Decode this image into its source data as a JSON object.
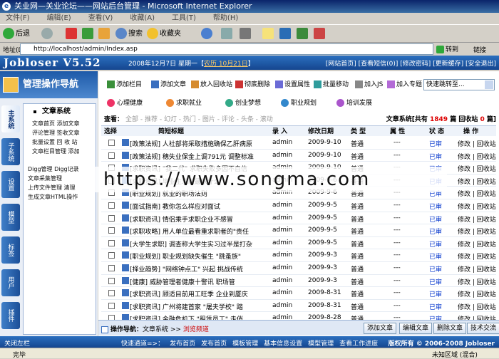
{
  "browser": {
    "title": "关业网—关业论坛——网站后台管理 - Microsoft Internet Explorer",
    "menu": [
      "文件(F)",
      "编辑(E)",
      "查看(V)",
      "收藏(A)",
      "工具(T)",
      "帮助(H)"
    ],
    "toolbar": {
      "back": "后退",
      "search": "搜索",
      "favorites": "收藏夹"
    },
    "address_label": "地址(D)",
    "address": "http://localhost/admin/Index.asp",
    "go": "转到",
    "links": "链接"
  },
  "header": {
    "brand": "Jobloser V5.52",
    "date_prefix": "2008年12月7日 星期一【",
    "lunar": "农历 10月21日",
    "date_suffix": "】",
    "links": "[网站首页] [查看短信(0)] [修改密码] [更新缓存] [安全退出]"
  },
  "left": {
    "panel_title": "管理操作导航",
    "tabs": [
      "主系统",
      "子系统",
      "设置",
      "模型",
      "标签",
      "用户",
      "插件"
    ],
    "section_title": "文章系统",
    "links": [
      "文章首页 添加文章",
      "评论管理 签收文章",
      "批量设置 回 收 站",
      "文章栏目管理 添加",
      "Digg管理 Digg记录",
      "文章采集管理",
      "上传文件管理 清理",
      "生成文章HTML操作"
    ]
  },
  "actions": [
    "添加栏目",
    "添加文章",
    "放入回收站",
    "彻底删除",
    "设置属性",
    "批量移动",
    "加入JS",
    "加入专题"
  ],
  "quickjump": "快速跳转至...",
  "categories": [
    "心理健康",
    "求职就业",
    "创业梦想",
    "职业规划",
    "培训发展"
  ],
  "view": {
    "label": "查看：",
    "filters": "全部 - 推荐 - 幻灯 - 热门 - 图片 - 评论 - 头条 - 滚动",
    "count_prefix": "文章系统[共有 ",
    "count": "1849",
    "count_mid": " 篇 回收站 ",
    "recycle": "0",
    "count_suffix": " 篇]"
  },
  "table": {
    "headers": [
      "选择",
      "简短标题",
      "录 入",
      "修改日期",
      "类 型",
      "属 性",
      "状 态",
      "操 作"
    ],
    "rows": [
      {
        "title": "[政策法规] 人社部将采取措施确保乙肝病原",
        "author": "admin",
        "date": "2009-9-10",
        "type": "普通",
        "attr": "---",
        "status": "已审",
        "ops": "修改 | 回收站"
      },
      {
        "title": "[政策法规] 穗失业保金上调791元 调整标准",
        "author": "admin",
        "date": "2009-9-10",
        "type": "普通",
        "attr": "---",
        "status": "已审",
        "ops": "修改 | 回收站"
      },
      {
        "title": "[求职资讯] \"我二代\" 求职失败多因不自信",
        "author": "admin",
        "date": "2009-9-10",
        "type": "普通",
        "attr": "---",
        "status": "已审",
        "ops": "修改 | 回收站"
      },
      {
        "title": "[求职资讯] 毕业生求职最缺什么",
        "author": "admin",
        "date": "2009-9-6",
        "type": "普通",
        "attr": "---",
        "status": "已审",
        "ops": "修改 | 回收站"
      },
      {
        "title": "[职业规划] 就业的职场法则",
        "author": "admin",
        "date": "2009-9-6",
        "type": "普通",
        "attr": "---",
        "status": "已审",
        "ops": "修改 | 回收站"
      },
      {
        "title": "[面试指南] 教你怎么样应对面试",
        "author": "admin",
        "date": "2009-9-5",
        "type": "普通",
        "attr": "---",
        "status": "已审",
        "ops": "修改 | 回收站"
      },
      {
        "title": "[求职资讯] 情侣乘手求职企业不感冒",
        "author": "admin",
        "date": "2009-9-5",
        "type": "普通",
        "attr": "---",
        "status": "已审",
        "ops": "修改 | 回收站"
      },
      {
        "title": "[求职攻略] 用人单位最看重求职者的\"责任",
        "author": "admin",
        "date": "2009-9-5",
        "type": "普通",
        "attr": "---",
        "status": "已审",
        "ops": "修改 | 回收站"
      },
      {
        "title": "[大学生求职] 调查称大学生实习过半是打杂",
        "author": "admin",
        "date": "2009-9-5",
        "type": "普通",
        "attr": "---",
        "status": "已审",
        "ops": "修改 | 回收站"
      },
      {
        "title": "[职业规划] 职业规划缺失催生 \"跳蚤族\"",
        "author": "admin",
        "date": "2009-9-3",
        "type": "普通",
        "attr": "---",
        "status": "已审",
        "ops": "修改 | 回收站"
      },
      {
        "title": "[择业趋势] \"网络钟点工\" 兴起  挑战传统",
        "author": "admin",
        "date": "2009-9-3",
        "type": "普通",
        "attr": "---",
        "status": "已审",
        "ops": "修改 | 回收站"
      },
      {
        "title": "[健康] 威胁管理者健康十警讯 职场管",
        "author": "admin",
        "date": "2009-9-3",
        "type": "普通",
        "attr": "---",
        "status": "已审",
        "ops": "修改 | 回收站"
      },
      {
        "title": "[求职资讯] 顾适目前用工旺季 企业到厦庆",
        "author": "admin",
        "date": "2009-8-31",
        "type": "普通",
        "attr": "---",
        "status": "已审",
        "ops": "修改 | 回收站"
      },
      {
        "title": "[求职资讯] 广州将建首家 \"屠夫学校\" 踏",
        "author": "admin",
        "date": "2009-8-31",
        "type": "普通",
        "attr": "---",
        "status": "已审",
        "ops": "修改 | 回收站"
      },
      {
        "title": "[求职资讯] 金融危机下 \"租赁员工\" 走俏",
        "author": "admin",
        "date": "2009-8-28",
        "type": "普通",
        "attr": "---",
        "status": "已审",
        "ops": "修改 | 回收站"
      }
    ]
  },
  "bottom": {
    "nav_label": "操作导航：",
    "nav_item": "文章系统 >> ",
    "nav_current": "浏览频道",
    "buttons": [
      "添加文章",
      "编辑文章",
      "删除文章",
      "技术交流"
    ]
  },
  "footer": {
    "close": "关闭左栏",
    "shortcuts_label": "快速通道=>：",
    "shortcuts": [
      "发布首页",
      "发布首页",
      "模板管理",
      "基本信息设置",
      "模型管理",
      "查看工作进度"
    ],
    "copyright": "版权所有 © 2006-2008 Jobloser"
  },
  "status": {
    "done": "完毕",
    "zone": "未知区域 (混合)"
  },
  "watermark": "https://www.songma.com"
}
